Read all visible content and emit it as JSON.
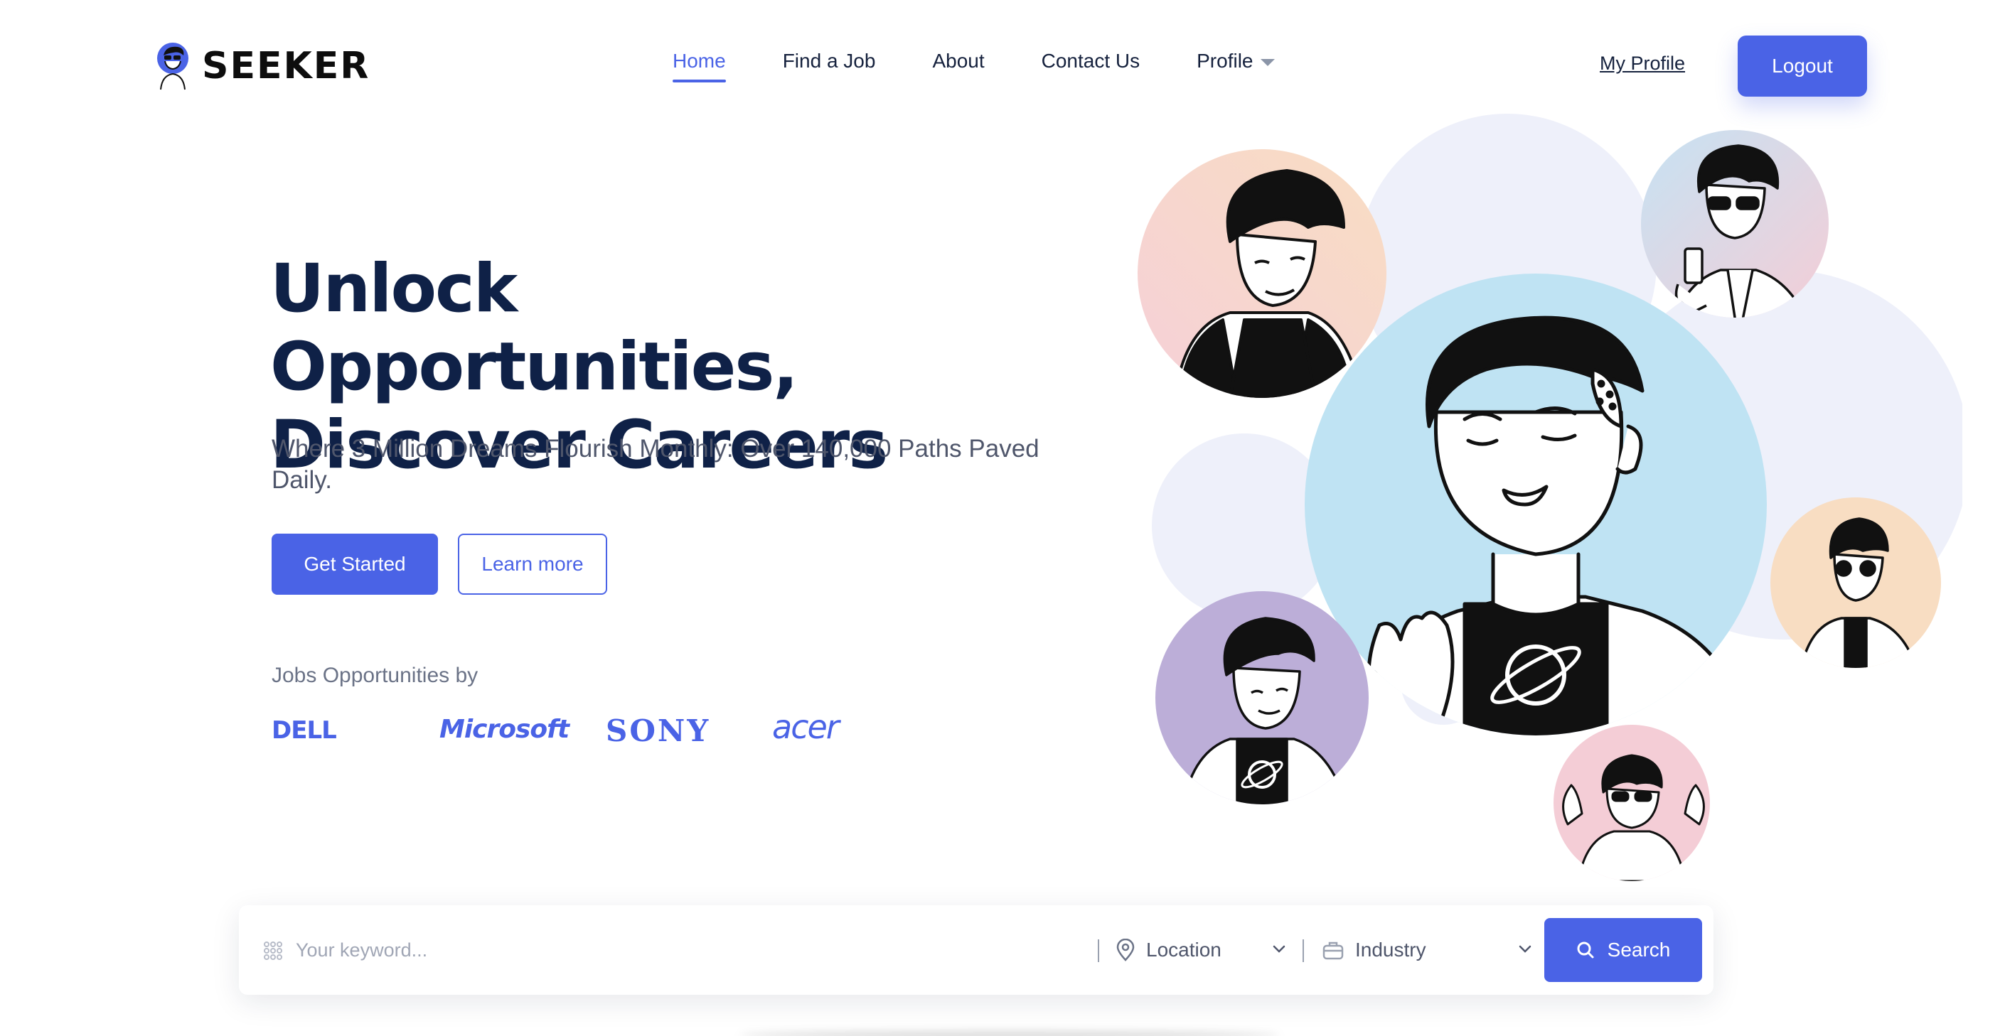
{
  "brand": {
    "name": "SEEKER"
  },
  "nav": {
    "items": [
      {
        "label": "Home",
        "active": true
      },
      {
        "label": "Find a Job",
        "active": false
      },
      {
        "label": "About",
        "active": false
      },
      {
        "label": "Contact Us",
        "active": false
      },
      {
        "label": "Profile",
        "active": false,
        "dropdown": true
      }
    ],
    "my_profile": "My Profile",
    "logout": "Logout"
  },
  "hero": {
    "title_line1": "Unlock Opportunities,",
    "title_line2": "Discover Careers",
    "subtitle": "Where 3 Million Dreams Flourish Monthly: Over 140,000 Paths Paved Daily.",
    "cta_primary": "Get Started",
    "cta_secondary": "Learn more",
    "jobs_by": "Jobs Opportunities by",
    "companies": [
      "DELL",
      "Microsoft",
      "SONY",
      "acer"
    ]
  },
  "search": {
    "keyword_placeholder": "Your keyword...",
    "location_label": "Location",
    "industry_label": "Industry",
    "button": "Search"
  },
  "colors": {
    "accent": "#4a63e6",
    "heading": "#0f2147",
    "body_text": "#4f566b",
    "circle_blue": "#bfe3f3",
    "circle_peach": "#f8dcc4",
    "circle_purple": "#bcaed8",
    "circle_pink": "#f4cdd6",
    "circle_pale": "#eef0fa"
  }
}
